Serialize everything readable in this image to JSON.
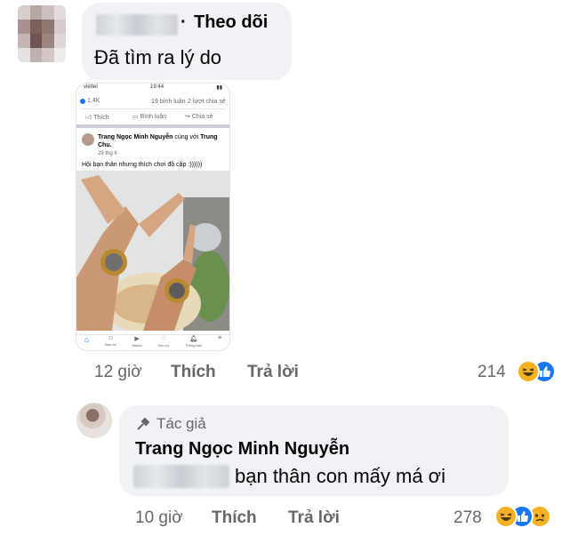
{
  "comment1": {
    "separator": "·",
    "follow_label": "Theo dõi",
    "text": "Đã tìm ra lý do",
    "time": "12 giờ",
    "like_label": "Thích",
    "reply_label": "Trả lời",
    "reaction_count": "214",
    "reactions": [
      "haha-icon",
      "like-icon"
    ]
  },
  "screenshot": {
    "status_carrier": "viettel",
    "status_time": "19:44",
    "reaction_count": "1,4K",
    "comments_count": "19 bình luận",
    "shares_count": "2 lượt chia sẻ",
    "like_label": "Thích",
    "comment_label": "Bình luận",
    "share_label": "Chia sẻ",
    "post_author": "Trang Ngọc Minh Nguyễn",
    "post_with": "cùng với",
    "post_tagged": "Trung Chu.",
    "post_date": "29 thg 6 ·",
    "post_text": "Hội bạn thân nhưng thích chơi đồ cặp :))))))",
    "nav": [
      "Bạn bè",
      "Watch",
      "Hẹn hò",
      "Thông báo"
    ]
  },
  "reply": {
    "badge_label": "Tác giả",
    "author": "Trang Ngọc Minh Nguyễn",
    "text": "bạn thân con mấy má ơi",
    "time": "10 giờ",
    "like_label": "Thích",
    "reply_label": "Trả lời",
    "reaction_count": "278",
    "reactions": [
      "haha-icon",
      "like-icon",
      "sad-icon"
    ]
  },
  "colors": {
    "bubble": "#f0f2f5",
    "like_blue": "#1877f2",
    "haha_yellow": "#f7b125",
    "meta_gray": "#65676b"
  }
}
